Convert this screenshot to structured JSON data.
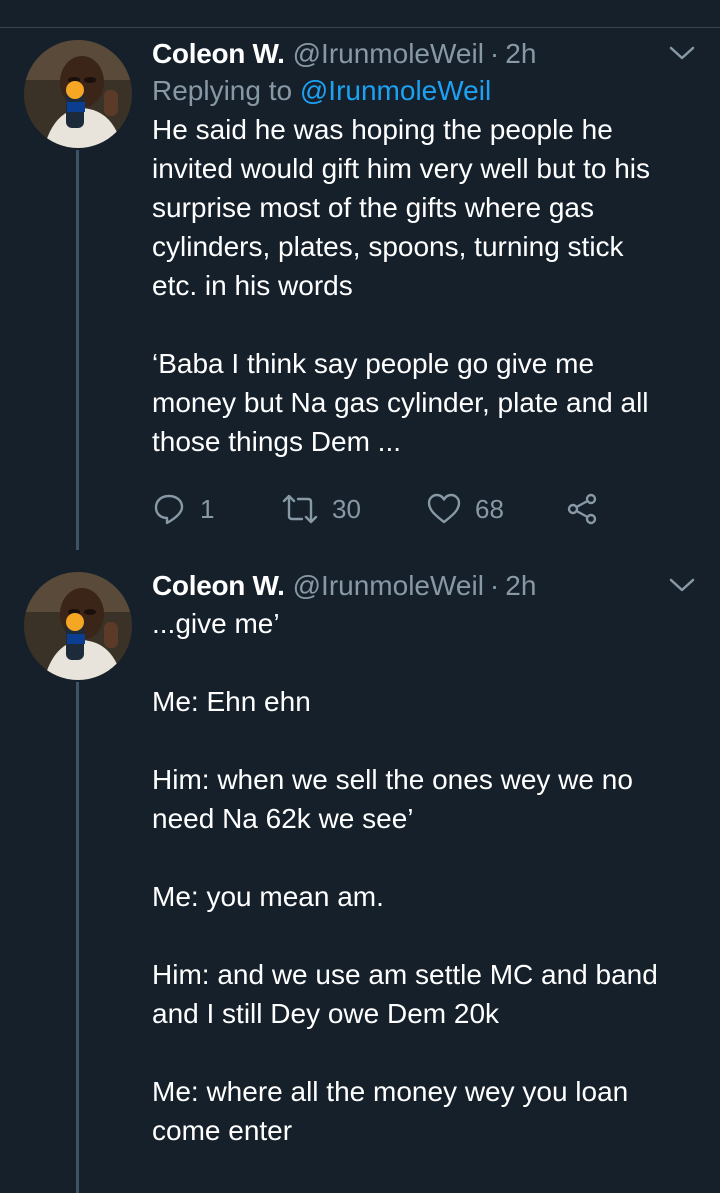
{
  "tweets": [
    {
      "name": "Coleon W.",
      "handle": "@IrunmoleWeil",
      "separator": "·",
      "time": "2h",
      "replying_prefix": "Replying to ",
      "replying_to": "@IrunmoleWeil",
      "body": "He said he was hoping the people he\ninvited would gift him very well but to his\nsurprise most of the gifts where gas\ncylinders, plates, spoons, turning stick\netc. in his words\n\n‘Baba I think say people go give me\nmoney but Na gas cylinder, plate and all\nthose things Dem ...",
      "replies": "1",
      "retweets": "30",
      "likes": "68"
    },
    {
      "name": "Coleon W.",
      "handle": "@IrunmoleWeil",
      "separator": "·",
      "time": "2h",
      "body": "...give me’\n\nMe: Ehn ehn\n\nHim: when we sell the ones wey we no\nneed Na 62k we see’\n\nMe: you mean am.\n\nHim: and we use am settle MC and band\nand I still Dey owe Dem 20k\n\nMe: where all the money wey you loan\ncome enter"
    }
  ],
  "colors": {
    "background": "#15202b",
    "secondary_text": "#8899a6",
    "mention": "#1da1f2",
    "thread_line": "#3d5466"
  },
  "icons": [
    "avatar-image",
    "chevron-down-icon",
    "reply-icon",
    "retweet-icon",
    "like-icon",
    "share-icon"
  ]
}
